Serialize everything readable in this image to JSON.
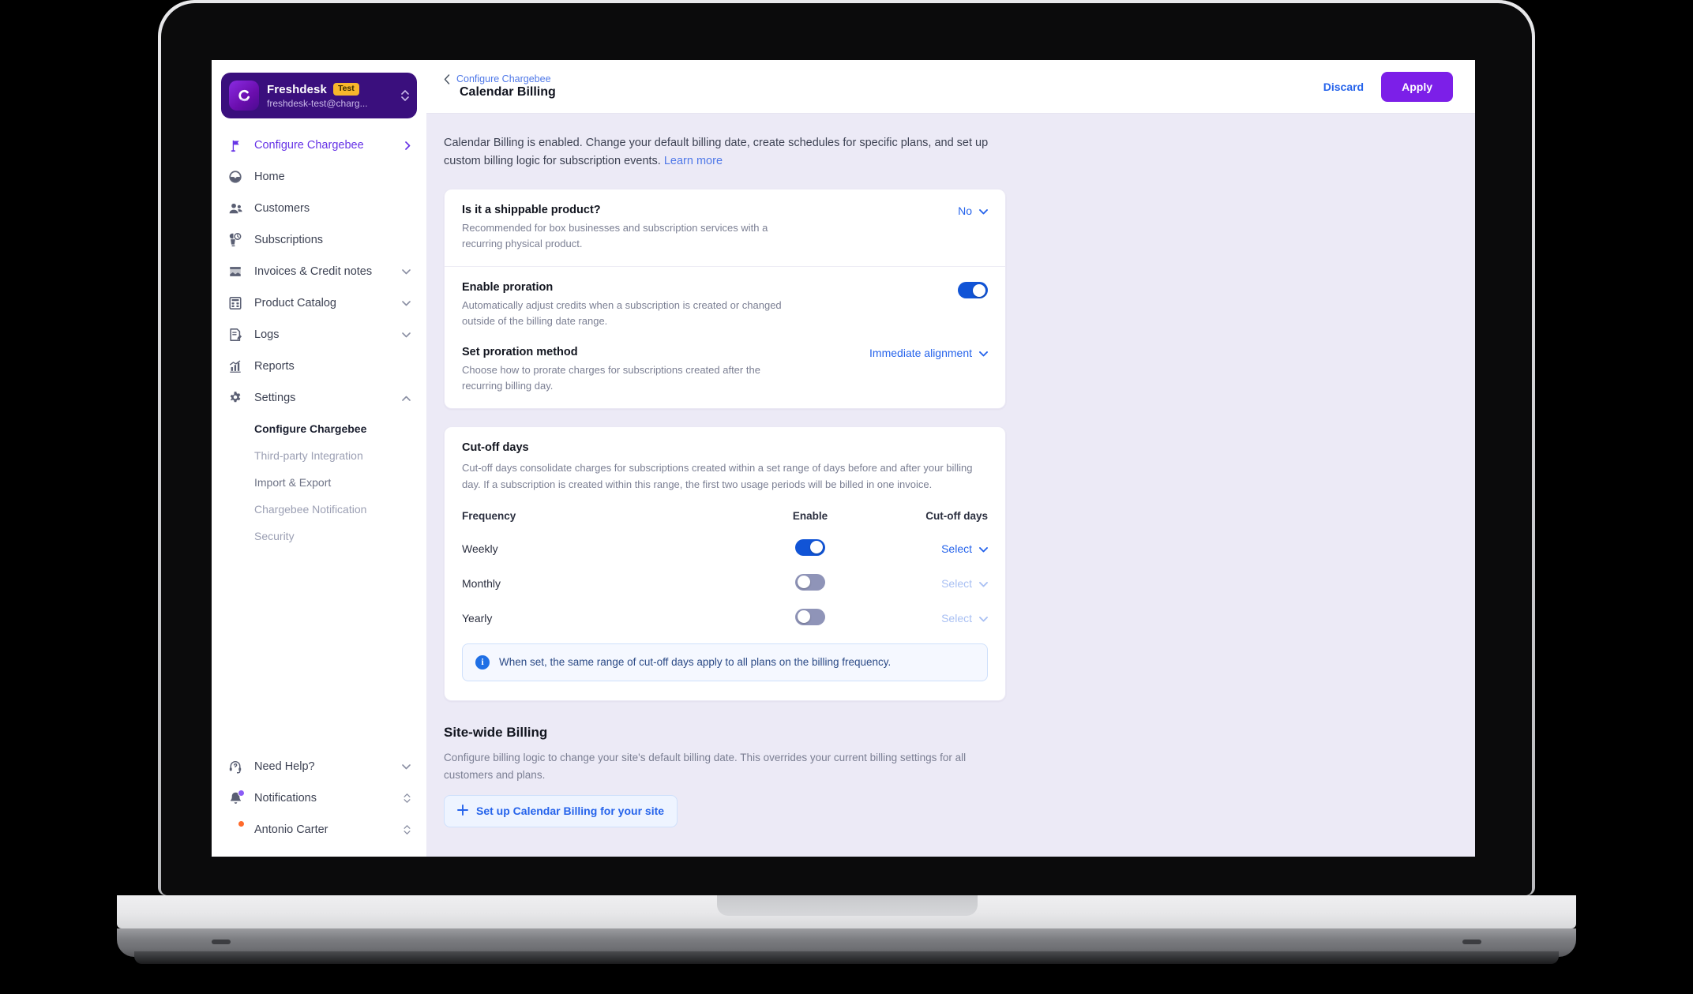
{
  "account": {
    "name": "Freshdesk",
    "badge": "Test",
    "email": "freshdesk-test@charg...",
    "logo_icon": "chargebee-logo-icon",
    "switcher_icon": "up-down-chevron-icon"
  },
  "sidebar": {
    "primary": [
      {
        "label": "Configure Chargebee",
        "icon": "flag-icon",
        "chevron": "chevron-right",
        "active": true
      },
      {
        "label": "Home",
        "icon": "speedometer-icon",
        "chevron": "",
        "active": false
      },
      {
        "label": "Customers",
        "icon": "people-icon",
        "chevron": "",
        "active": false
      },
      {
        "label": "Subscriptions",
        "icon": "subscription-icon",
        "chevron": "",
        "active": false
      },
      {
        "label": "Invoices & Credit notes",
        "icon": "invoice-icon",
        "chevron": "chevron-down",
        "active": false
      },
      {
        "label": "Product Catalog",
        "icon": "catalog-icon",
        "chevron": "chevron-down",
        "active": false
      },
      {
        "label": "Logs",
        "icon": "logs-icon",
        "chevron": "chevron-down",
        "active": false
      },
      {
        "label": "Reports",
        "icon": "chart-icon",
        "chevron": "",
        "active": false
      },
      {
        "label": "Settings",
        "icon": "gear-icon",
        "chevron": "chevron-up",
        "active": false
      }
    ],
    "settings_subitems": [
      {
        "label": "Configure Chargebee",
        "state": "current"
      },
      {
        "label": "Third-party Integration",
        "state": "muted"
      },
      {
        "label": "Import & Export",
        "state": "semi"
      },
      {
        "label": "Chargebee Notification",
        "state": "muted"
      },
      {
        "label": "Security",
        "state": "muted"
      }
    ],
    "bottom": [
      {
        "label": "Need Help?",
        "icon": "headset-help-icon",
        "chevron": "chevron-down",
        "badge": ""
      },
      {
        "label": "Notifications",
        "icon": "bell-icon",
        "chevron": "up-down-chevron-icon",
        "badge": "purple-dot"
      },
      {
        "label": "Antonio Carter",
        "icon": "avatar",
        "chevron": "up-down-chevron-icon",
        "badge": "orange-dot"
      }
    ]
  },
  "topbar": {
    "back_icon": "chevron-left-icon",
    "breadcrumb": "Configure Chargebee",
    "title": "Calendar Billing",
    "discard_label": "Discard",
    "apply_label": "Apply"
  },
  "intro": {
    "text": "Calendar Billing is enabled. Change your default billing date, create schedules for specific plans, and set up custom billing logic for subscription events.",
    "link": "Learn more"
  },
  "settings_card": {
    "shippable": {
      "title": "Is it a shippable product?",
      "desc": "Recommended for box businesses and subscription services with a recurring physical product.",
      "value": "No",
      "chevron_icon": "chevron-down-icon"
    },
    "proration": {
      "title": "Enable proration",
      "desc": "Automatically adjust credits when a subscription is created or changed outside of the billing date range.",
      "enabled": true
    },
    "proration_method": {
      "title": "Set proration method",
      "desc": "Choose how to prorate charges for subscriptions created after the recurring billing day.",
      "value": "Immediate alignment",
      "chevron_icon": "chevron-down-icon"
    }
  },
  "cutoff_card": {
    "title": "Cut-off days",
    "desc": "Cut-off days consolidate charges for subscriptions created within a set range of days before and after your billing day. If a subscription is created within this range, the first two usage periods will be billed in one invoice.",
    "columns": [
      "Frequency",
      "Enable",
      "Cut-off days"
    ],
    "rows": [
      {
        "frequency": "Weekly",
        "enabled": true,
        "select_label": "Select"
      },
      {
        "frequency": "Monthly",
        "enabled": false,
        "select_label": "Select"
      },
      {
        "frequency": "Yearly",
        "enabled": false,
        "select_label": "Select"
      }
    ],
    "info_icon": "info-icon",
    "info": "When set, the same range of cut-off days apply to all plans on the billing frequency."
  },
  "sitewide": {
    "title": "Site-wide Billing",
    "desc": "Configure billing logic to change your site's default billing date. This overrides your current billing settings for all customers and plans.",
    "button_label": "Set up Calendar Billing for your site",
    "button_icon": "plus-icon"
  },
  "colors": {
    "brand_purple": "#7c1fe8",
    "sidebar_active": "#6633e6",
    "link_blue": "#2563eb",
    "toggle_on": "#1154d6",
    "toggle_off": "#8f94b8",
    "page_bg": "#eceaf6",
    "badge_yellow": "#f8b62b"
  }
}
